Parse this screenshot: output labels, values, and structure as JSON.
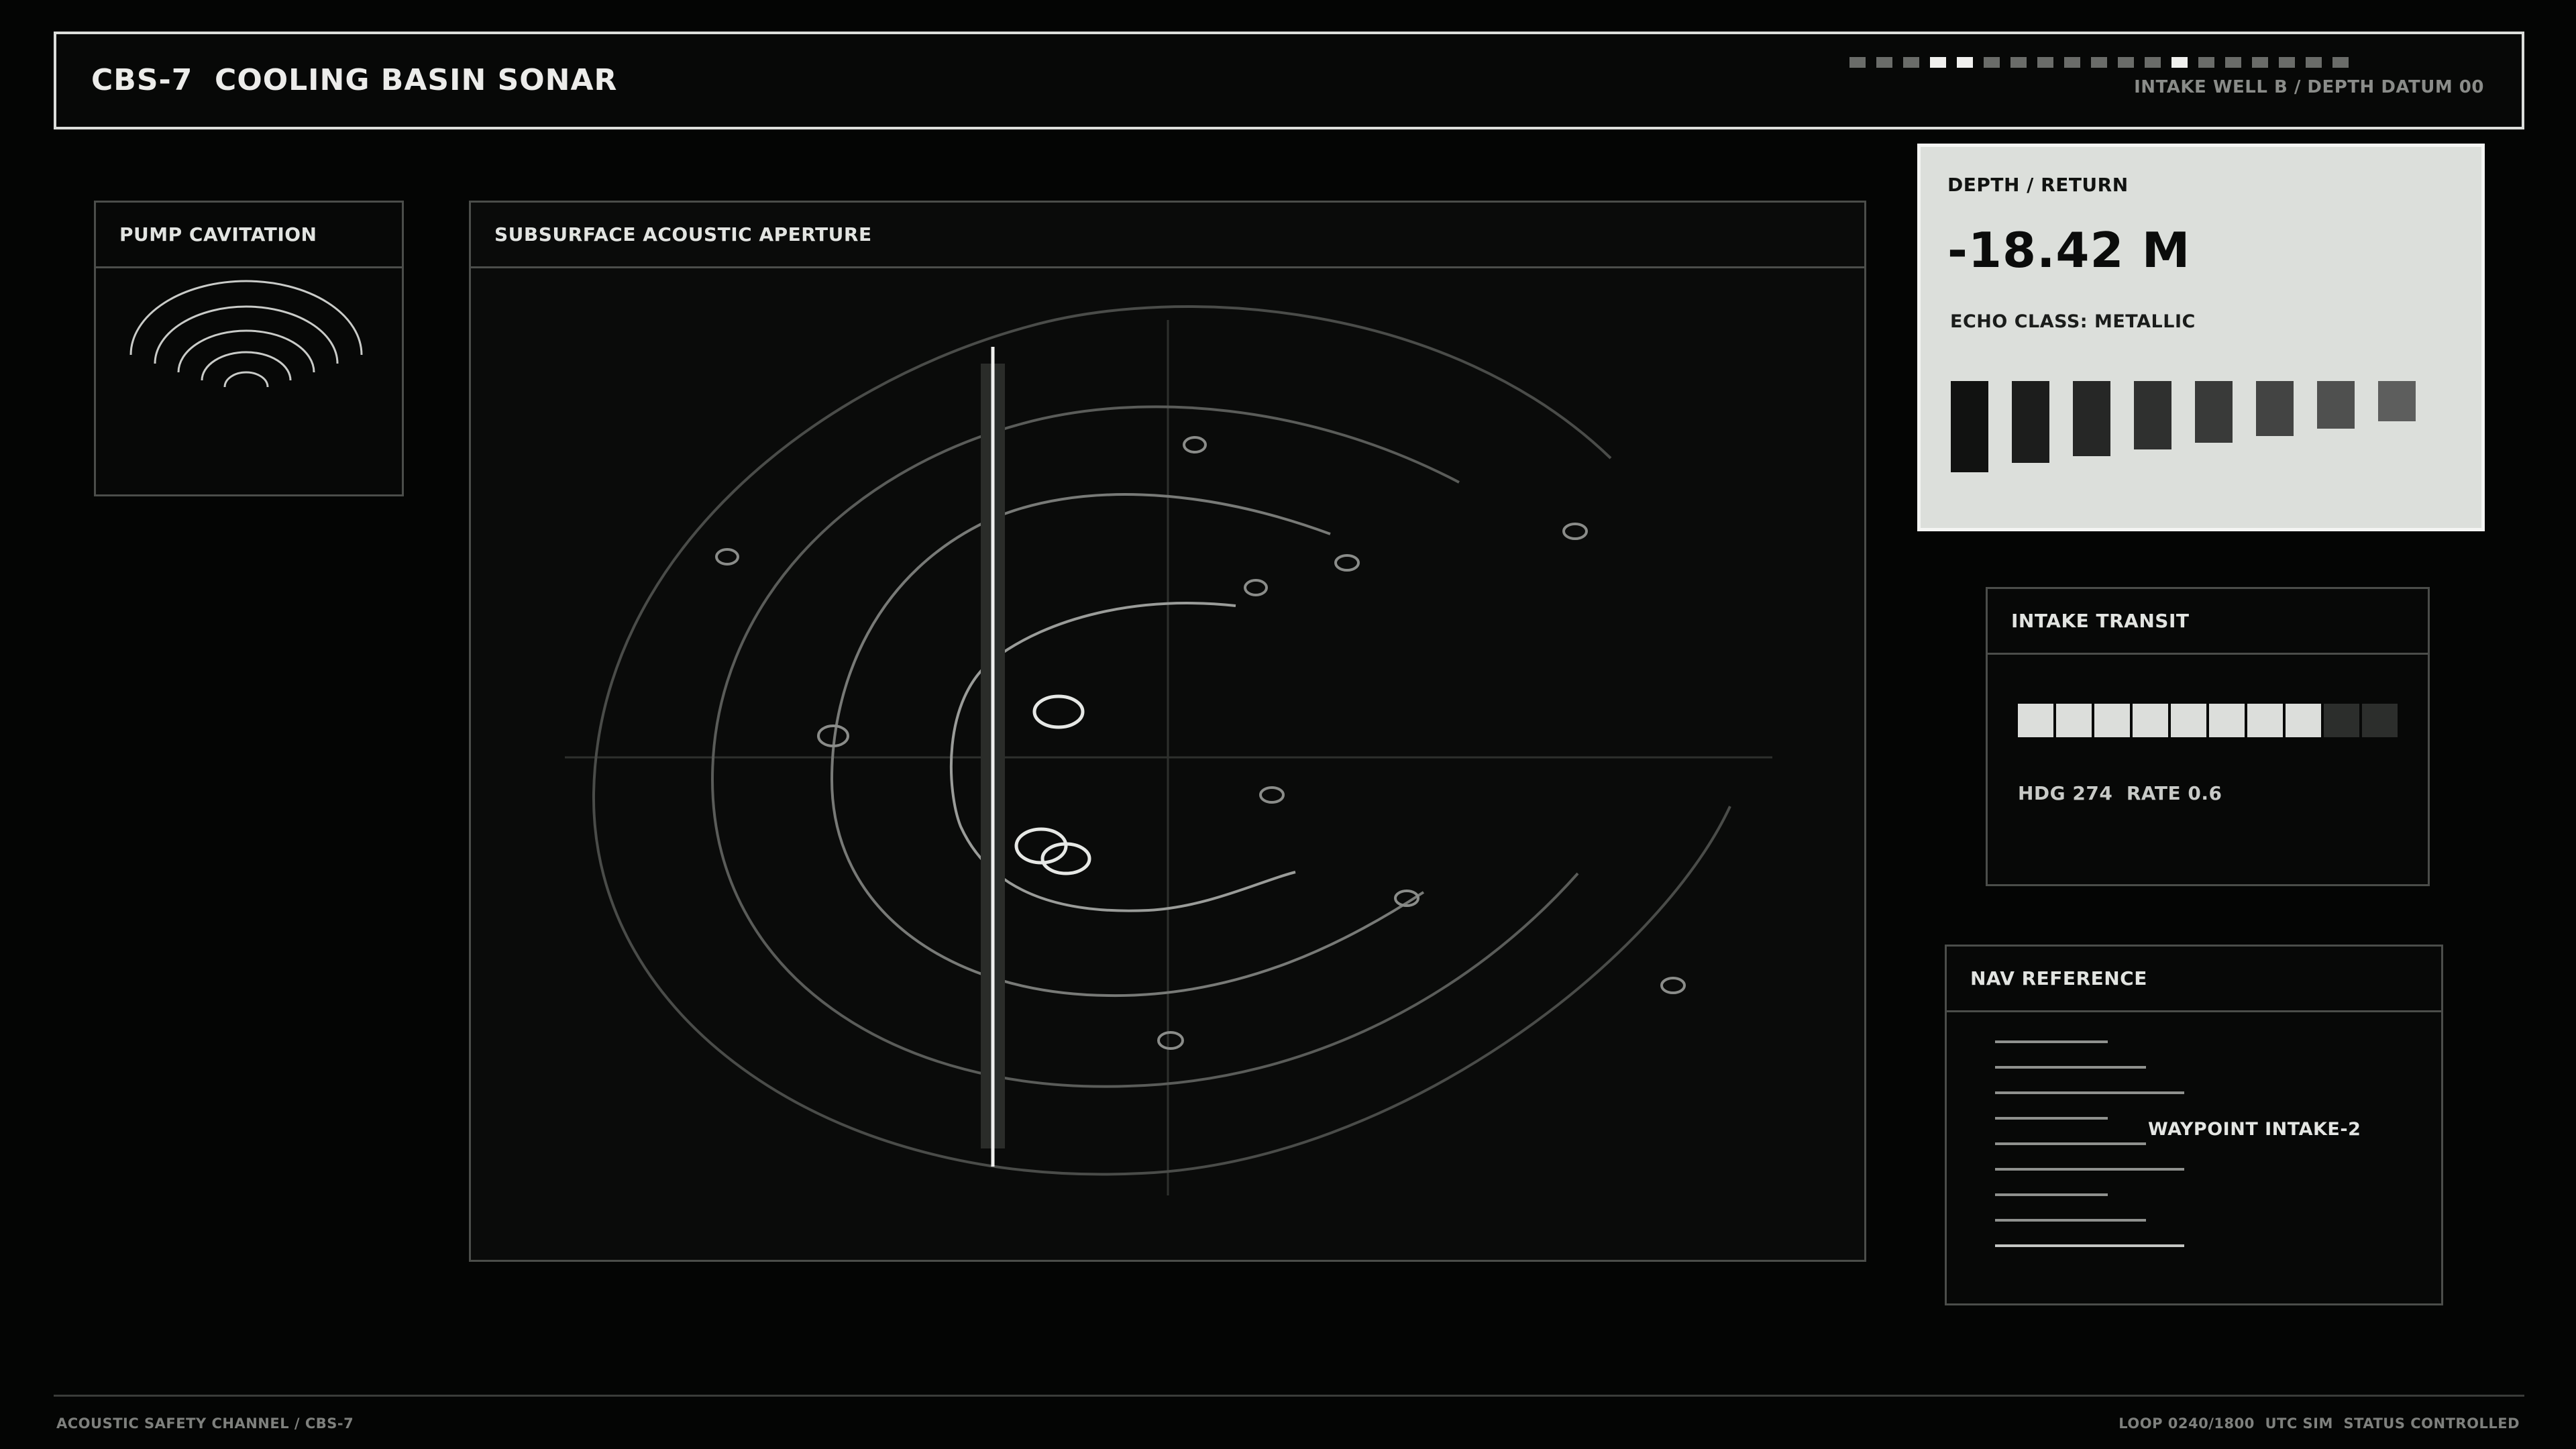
{
  "header": {
    "title": "CBS-7  COOLING BASIN SONAR",
    "subtitle": "INTAKE WELL B / DEPTH DATUM 00",
    "progress": {
      "total": 19,
      "active": [
        3,
        4,
        12
      ]
    }
  },
  "pump_panel": {
    "title": "PUMP CAVITATION",
    "icon": "cavitation-waves-icon"
  },
  "sonar_panel": {
    "title": "SUBSURFACE ACOUSTIC APERTURE"
  },
  "depth_panel": {
    "title": "DEPTH / RETURN",
    "value": "-18.42 M",
    "echo_class": "ECHO CLASS: METALLIC",
    "echo_levels": [
      1.0,
      0.9,
      0.82,
      0.75,
      0.68,
      0.6,
      0.52,
      0.44
    ],
    "echo_colors": [
      "#111211",
      "#1c1d1c",
      "#262726",
      "#2f302f",
      "#393a39",
      "#434443",
      "#4f504f",
      "#5d5e5d"
    ]
  },
  "transit_panel": {
    "title": "INTAKE TRANSIT",
    "level": 0.8,
    "segments": 10,
    "readout": "HDG 274  RATE 0.6"
  },
  "nav_panel": {
    "title": "NAV REFERENCE",
    "waypoint": "WAYPOINT INTAKE-2"
  },
  "footer": {
    "left": "ACOUSTIC SAFETY CHANNEL / CBS-7",
    "right": "LOOP 0240/1800  UTC SIM  STATUS CONTROLLED"
  },
  "colors": {
    "background": "#040504",
    "panel_border": "#4b4d4a",
    "accent_light": "#dcdfdb",
    "text": "#dcdedb"
  }
}
